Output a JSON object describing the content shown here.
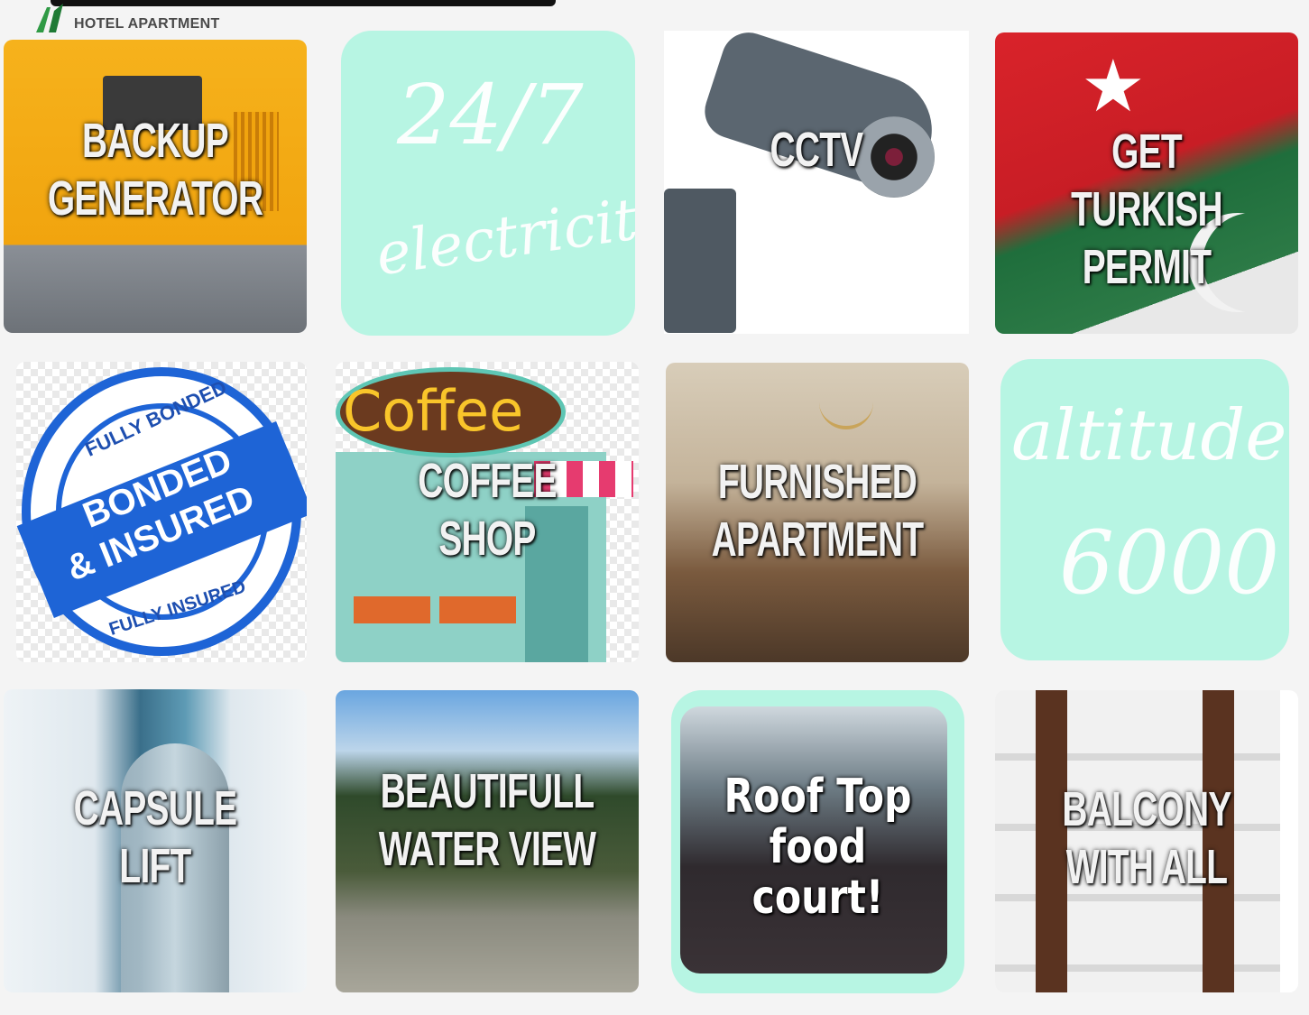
{
  "logo": {
    "text": "HOTEL APARTMENT"
  },
  "tiles": [
    {
      "caption_line1": "BACKUP",
      "caption_line2": "GENERATOR"
    },
    {
      "line1": "24/7",
      "line2": "electricity"
    },
    {
      "caption_line1": "CCTV"
    },
    {
      "caption_line1": "GET TURKISH",
      "caption_line2": "PERMIT"
    },
    {
      "stamp_top": "FULLY BONDED",
      "stamp_mid1": "BONDED",
      "stamp_mid2": "& INSURED",
      "stamp_bottom": "FULLY INSURED"
    },
    {
      "sign": "Coffee",
      "caption_line1": "COFFEE",
      "caption_line2": "SHOP"
    },
    {
      "caption_line1": "FURNISHED",
      "caption_line2": "APARTMENT"
    },
    {
      "line1": "altitude",
      "line2": "6000"
    },
    {
      "caption_line1": "CAPSULE LIFT"
    },
    {
      "caption_line1": "BEAUTIFULL",
      "caption_line2": "WATER VIEW"
    },
    {
      "caption_line1": "Roof Top",
      "caption_line2": "food court!"
    },
    {
      "caption_line1": "BALCONY",
      "caption_line2": "WITH ALL"
    }
  ],
  "colors": {
    "mint": "#b7f5e3",
    "caption": "#f2f2f2"
  }
}
